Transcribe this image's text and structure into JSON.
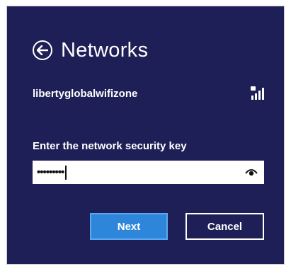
{
  "dialog": {
    "title": "Networks",
    "back_icon": "back-arrow-icon"
  },
  "network": {
    "name": "libertyglobalwifizone",
    "signal_icon": "wifi-signal-secured-icon"
  },
  "security": {
    "label": "Enter the network security key",
    "masked_value": "•••••••••",
    "reveal_icon": "reveal-password-icon"
  },
  "buttons": {
    "next_label": "Next",
    "cancel_label": "Cancel"
  },
  "colors": {
    "panel_background": "#1f1f57",
    "accent": "#2e86da",
    "text": "#ffffff"
  }
}
